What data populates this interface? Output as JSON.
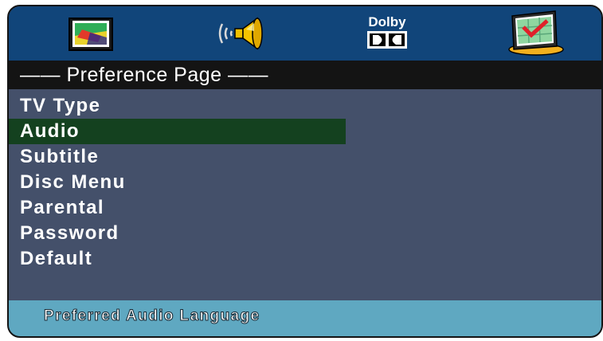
{
  "toolbar": {
    "icons": [
      {
        "name": "tv-screen-icon"
      },
      {
        "name": "speaker-icon"
      },
      {
        "name": "dolby-icon",
        "label": "Dolby"
      },
      {
        "name": "preference-checklist-icon"
      }
    ]
  },
  "page": {
    "title": "—— Preference Page ——"
  },
  "menu": {
    "items": [
      {
        "label": "TV Type"
      },
      {
        "label": "Audio",
        "selected": true
      },
      {
        "label": "Subtitle"
      },
      {
        "label": "Disc Menu"
      },
      {
        "label": "Parental"
      },
      {
        "label": "Password"
      },
      {
        "label": "Default"
      }
    ]
  },
  "status": {
    "text": "Preferred Audio Language"
  },
  "colors": {
    "icon_bar": "#11457a",
    "page_bar": "#141414",
    "menu_bg": "#44506a",
    "selected_bg": "#14411f",
    "status_bar": "#5fa8c1"
  }
}
